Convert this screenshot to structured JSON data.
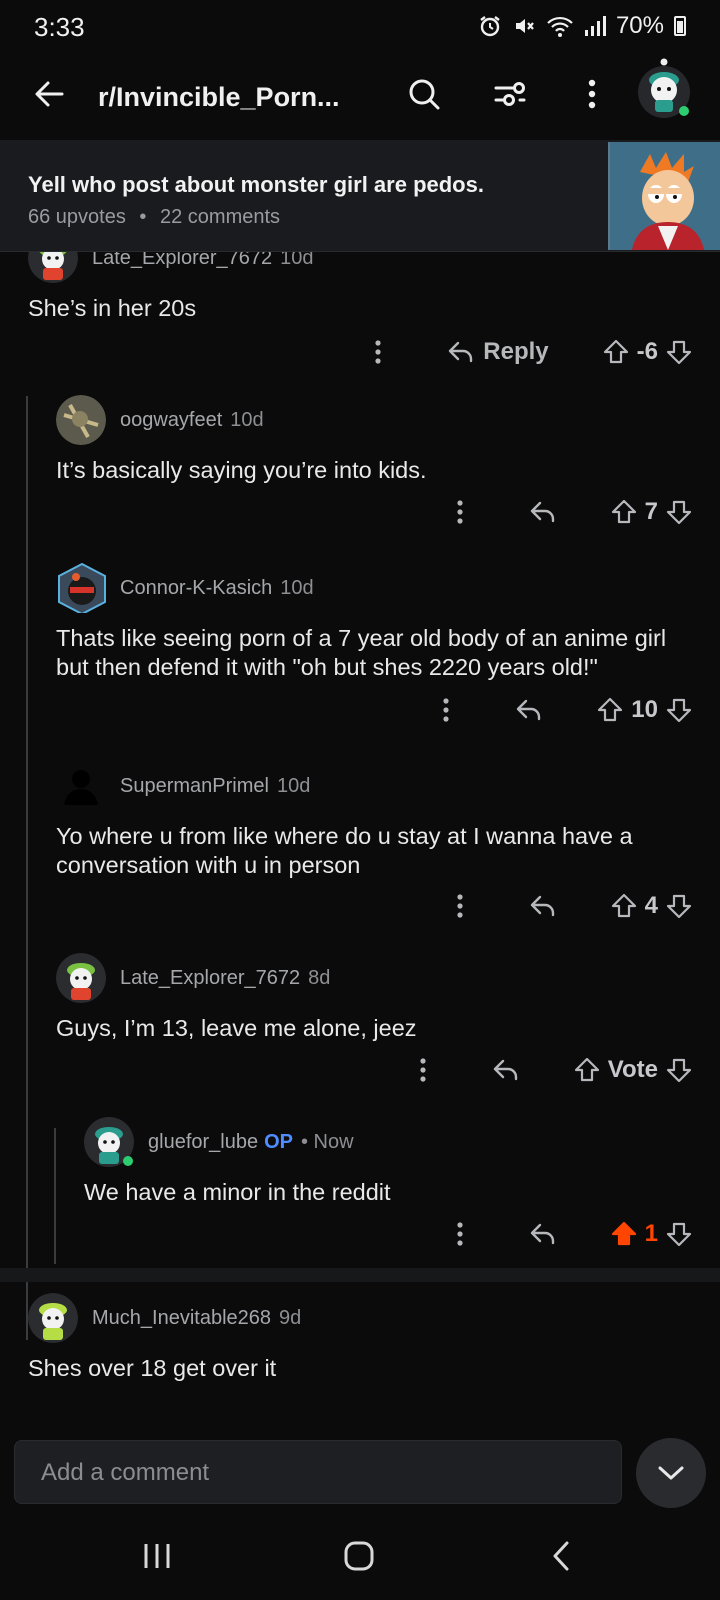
{
  "status_bar": {
    "time": "3:33",
    "battery": "70%",
    "icons": [
      "alarm-icon",
      "mute-icon",
      "wifi-icon",
      "signal-icon",
      "battery-icon"
    ]
  },
  "header": {
    "subreddit": "r/Invincible_Porn...",
    "icons": [
      "back-arrow-icon",
      "search-icon",
      "filter-icon",
      "more-icon",
      "profile-avatar"
    ]
  },
  "post": {
    "title": "Yell who post about monster girl are pedos.",
    "upvotes": "66 upvotes",
    "separator": "•",
    "comments": "22 comments"
  },
  "comments": [
    {
      "author": "Late_Explorer_7672",
      "age": "10d",
      "body": "She’s in her 20s",
      "reply_label": "Reply",
      "votes": "-6"
    },
    {
      "author": "oogwayfeet",
      "age": "10d",
      "body": "It’s basically saying you’re into kids.",
      "votes": "7"
    },
    {
      "author": "Connor-K-Kasich",
      "age": "10d",
      "body": "Thats like seeing porn of a 7 year old body of an anime girl but then defend it with \"oh but shes 2220 years old!\"",
      "votes": "10"
    },
    {
      "author": "SupermanPrimel",
      "age": "10d",
      "body": "Yo where u from like where do u stay at I wanna have a conversation with u in person",
      "votes": "4"
    },
    {
      "author": "Late_Explorer_7672",
      "age": "8d",
      "body": "Guys, I’m 13, leave me alone, jeez",
      "votes": "Vote"
    },
    {
      "author": "gluefor_lube",
      "op_badge": "OP",
      "age": "• Now",
      "body": "We have a minor in the reddit",
      "votes": "1",
      "upvoted": true
    },
    {
      "author": "Much_Inevitable268",
      "age": "9d",
      "body": "Shes over 18 get over it"
    }
  ],
  "comment_bar": {
    "placeholder": "Add a comment"
  },
  "colors": {
    "background": "#0b0b0c",
    "upvote_active": "#ff4500",
    "op_badge": "#4f8cff",
    "thread_line": "#3b3c40"
  }
}
